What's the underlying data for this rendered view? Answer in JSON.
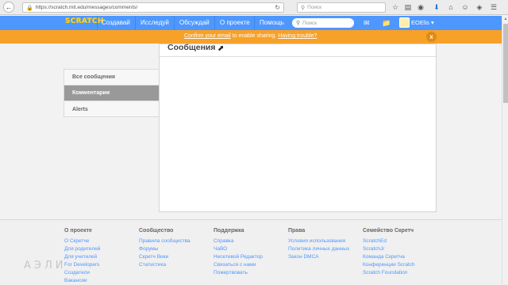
{
  "browser": {
    "url": "https://scratch.mit.edu/messages/comments/",
    "search_placeholder": "Поиск"
  },
  "nav": {
    "logo": "SCRATCH",
    "items": [
      "Создавай",
      "Исследуй",
      "Обсуждай",
      "О проекте",
      "Помощь"
    ],
    "search_placeholder": "Поиск",
    "username": "EOElis ▾"
  },
  "banner": {
    "link1": "Confirm your email",
    "middle": " to enable sharing. ",
    "link2": "Having trouble?",
    "close": "x"
  },
  "messages": {
    "title": "Сообщения"
  },
  "sidebar": {
    "items": [
      {
        "label": "Все сообщения"
      },
      {
        "label": "Комментарии"
      },
      {
        "label": "Alerts"
      }
    ]
  },
  "footer": {
    "columns": [
      {
        "heading": "О проекте",
        "links": [
          "О Скретче",
          "Для родителей",
          "Для учителей",
          "For Developers",
          "Создатели",
          "Вакансии"
        ]
      },
      {
        "heading": "Сообщество",
        "links": [
          "Правила сообщества",
          "Форумы",
          "Скретч Вики",
          "Статистика"
        ]
      },
      {
        "heading": "Поддержка",
        "links": [
          "Справка",
          "ЧаВО",
          "Несетевой Редактор",
          "Связаться с нами",
          "Пожертвовать"
        ]
      },
      {
        "heading": "Права",
        "links": [
          "Условия использования",
          "Политика личных данных",
          "Закон DMCA"
        ]
      },
      {
        "heading": "Семейство Скретч",
        "links": [
          "ScratchEd",
          "ScratchJr",
          "Команда Скретча",
          "Конференции Scratch",
          "Scratch Foundation"
        ]
      }
    ]
  },
  "watermark": "АЭЛИ",
  "colors": {
    "nav_blue": "#4d97ff",
    "banner_orange": "#f7a128",
    "link_blue": "#4d97ff",
    "active_tab_gray": "#999999"
  }
}
